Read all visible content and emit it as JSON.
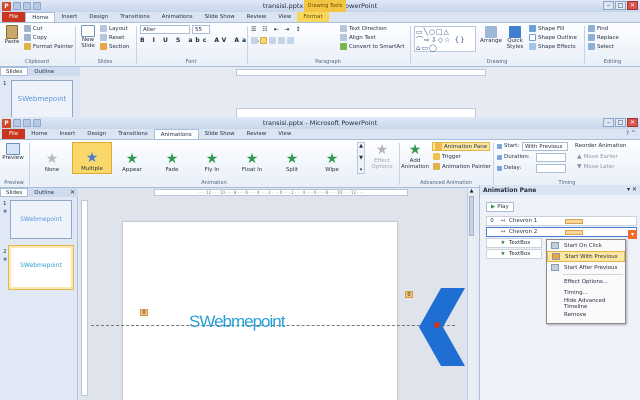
{
  "back_window": {
    "title": "transisi.pptx - Microsoft PowerPoint",
    "contextual_tab_group": "Drawing Tools",
    "tabs": [
      "File",
      "Home",
      "Insert",
      "Design",
      "Transitions",
      "Animations",
      "Slide Show",
      "Review",
      "View",
      "Format"
    ],
    "active_tab": "Home",
    "clipboard": {
      "paste": "Paste",
      "cut": "Cut",
      "copy": "Copy",
      "format_painter": "Format Painter",
      "label": "Clipboard"
    },
    "slides": {
      "new_slide": "New Slide",
      "layout": "Layout",
      "reset": "Reset",
      "section": "Section",
      "label": "Slides"
    },
    "font": {
      "name": "Aller",
      "size": "55",
      "label": "Font"
    },
    "paragraph": {
      "text_direction": "Text Direction",
      "align_text": "Align Text",
      "convert": "Convert to SmartArt",
      "label": "Paragraph"
    },
    "drawing": {
      "arrange": "Arrange",
      "quick_styles": "Quick Styles",
      "shape_fill": "Shape Fill",
      "shape_outline": "Shape Outline",
      "shape_effects": "Shape Effects",
      "label": "Drawing"
    },
    "editing": {
      "find": "Find",
      "replace": "Replace",
      "select": "Select",
      "label": "Editing"
    },
    "panel_tabs": [
      "Slides",
      "Outline"
    ],
    "thumb_num": "1",
    "thumb_text": "SWebmepoint"
  },
  "front_window": {
    "title": "transisi.pptx - Microsoft PowerPoint",
    "tabs": [
      "File",
      "Home",
      "Insert",
      "Design",
      "Transitions",
      "Animations",
      "Slide Show",
      "Review",
      "View"
    ],
    "active_tab": "Animations",
    "preview": {
      "label": "Preview",
      "group": "Preview"
    },
    "animations": [
      {
        "name": "None",
        "color": "#b8b8b8"
      },
      {
        "name": "Multiple",
        "color": "#4a7bd0"
      },
      {
        "name": "Appear",
        "color": "#2e9a4a"
      },
      {
        "name": "Fade",
        "color": "#2e9a4a"
      },
      {
        "name": "Fly In",
        "color": "#2e9a4a"
      },
      {
        "name": "Float In",
        "color": "#2e9a4a"
      },
      {
        "name": "Split",
        "color": "#2e9a4a"
      },
      {
        "name": "Wipe",
        "color": "#2e9a4a"
      }
    ],
    "effect_options": "Effect Options",
    "animation_group": "Animation",
    "add_animation": "Add Animation",
    "animation_pane_btn": "Animation Pane",
    "trigger": "Trigger",
    "animation_painter": "Animation Painter",
    "advanced_group": "Advanced Animation",
    "timing": {
      "start_label": "Start:",
      "start_value": "With Previous",
      "duration_label": "Duration:",
      "delay_label": "Delay:",
      "reorder": "Reorder Animation",
      "earlier": "Move Earlier",
      "later": "Move Later",
      "group": "Timing"
    },
    "panel_tabs": [
      "Slides",
      "Outline"
    ],
    "thumbs": [
      {
        "num": "1",
        "text": "SWebmepoint"
      },
      {
        "num": "2",
        "text": "SWebmepoint"
      }
    ],
    "slide_text": "SWebmepoint",
    "slide_tag": "0",
    "chevron_tag": "0"
  },
  "animation_pane": {
    "title": "Animation Pane",
    "play": "Play",
    "items": [
      {
        "num": "0",
        "name": "Chevron 1"
      },
      {
        "num": "",
        "name": "Chevron 2"
      },
      {
        "num": "",
        "name": "TextBox"
      },
      {
        "num": "",
        "name": "TextBox"
      }
    ],
    "menu": [
      {
        "label": "Start On Click",
        "selected": false
      },
      {
        "label": "Start With Previous",
        "selected": true
      },
      {
        "label": "Start After Previous",
        "selected": false
      },
      {
        "label": "Effect Options...",
        "selected": false
      },
      {
        "label": "Timing...",
        "selected": false
      },
      {
        "label": "Hide Advanced Timeline",
        "selected": false
      },
      {
        "label": "Remove",
        "selected": false
      }
    ]
  },
  "colors": {
    "accent": "#1e6fd6",
    "file_tab": "#c8361f",
    "chevron": "#1f6ed4",
    "slide_text": "#2aa0d9"
  }
}
